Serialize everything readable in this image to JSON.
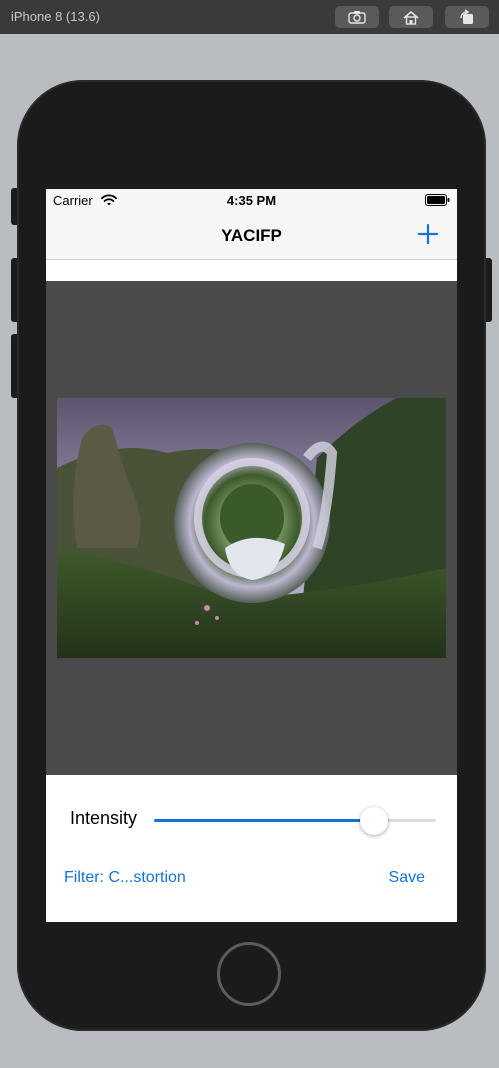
{
  "simulator": {
    "title": "iPhone 8 (13.6)",
    "buttons": [
      "screenshot-icon",
      "home-icon",
      "rotate-icon"
    ]
  },
  "status_bar": {
    "carrier": "Carrier",
    "time": "4:35 PM",
    "icons": [
      "wifi-icon",
      "battery-icon"
    ]
  },
  "nav": {
    "title": "YACIFP",
    "add_icon": "plus-icon"
  },
  "controls": {
    "intensity_label": "Intensity",
    "intensity_value": 0.78,
    "filter_label": "Filter: C...stortion",
    "save_label": "Save"
  },
  "colors": {
    "accent": "#1273d8",
    "image_background": "#4a4a4a"
  }
}
